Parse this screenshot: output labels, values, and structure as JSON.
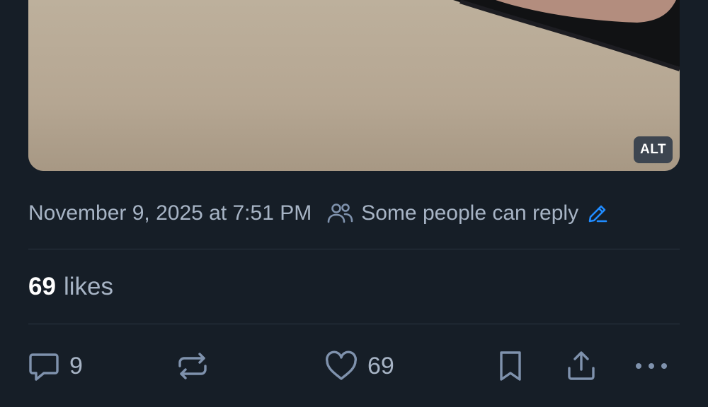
{
  "post": {
    "media": {
      "alt_badge": "ALT"
    },
    "timestamp": "November 9, 2025 at 7:51 PM",
    "reply_setting": {
      "label": "Some people can reply",
      "icon": "people-icon",
      "edit_icon": "pencil-icon"
    },
    "likes": {
      "count": "69",
      "label": "likes"
    },
    "actions": {
      "reply": {
        "icon": "comment-icon",
        "count": "9"
      },
      "repost": {
        "icon": "repost-icon",
        "count": ""
      },
      "like": {
        "icon": "heart-icon",
        "count": "69"
      },
      "bookmark": {
        "icon": "bookmark-icon"
      },
      "share": {
        "icon": "share-icon"
      },
      "more": {
        "icon": "ellipsis-icon"
      }
    }
  },
  "colors": {
    "background": "#161e27",
    "muted_text": "#a7b4c5",
    "primary_text": "#ffffff",
    "accent": "#208bfe",
    "divider": "#2b3541"
  }
}
